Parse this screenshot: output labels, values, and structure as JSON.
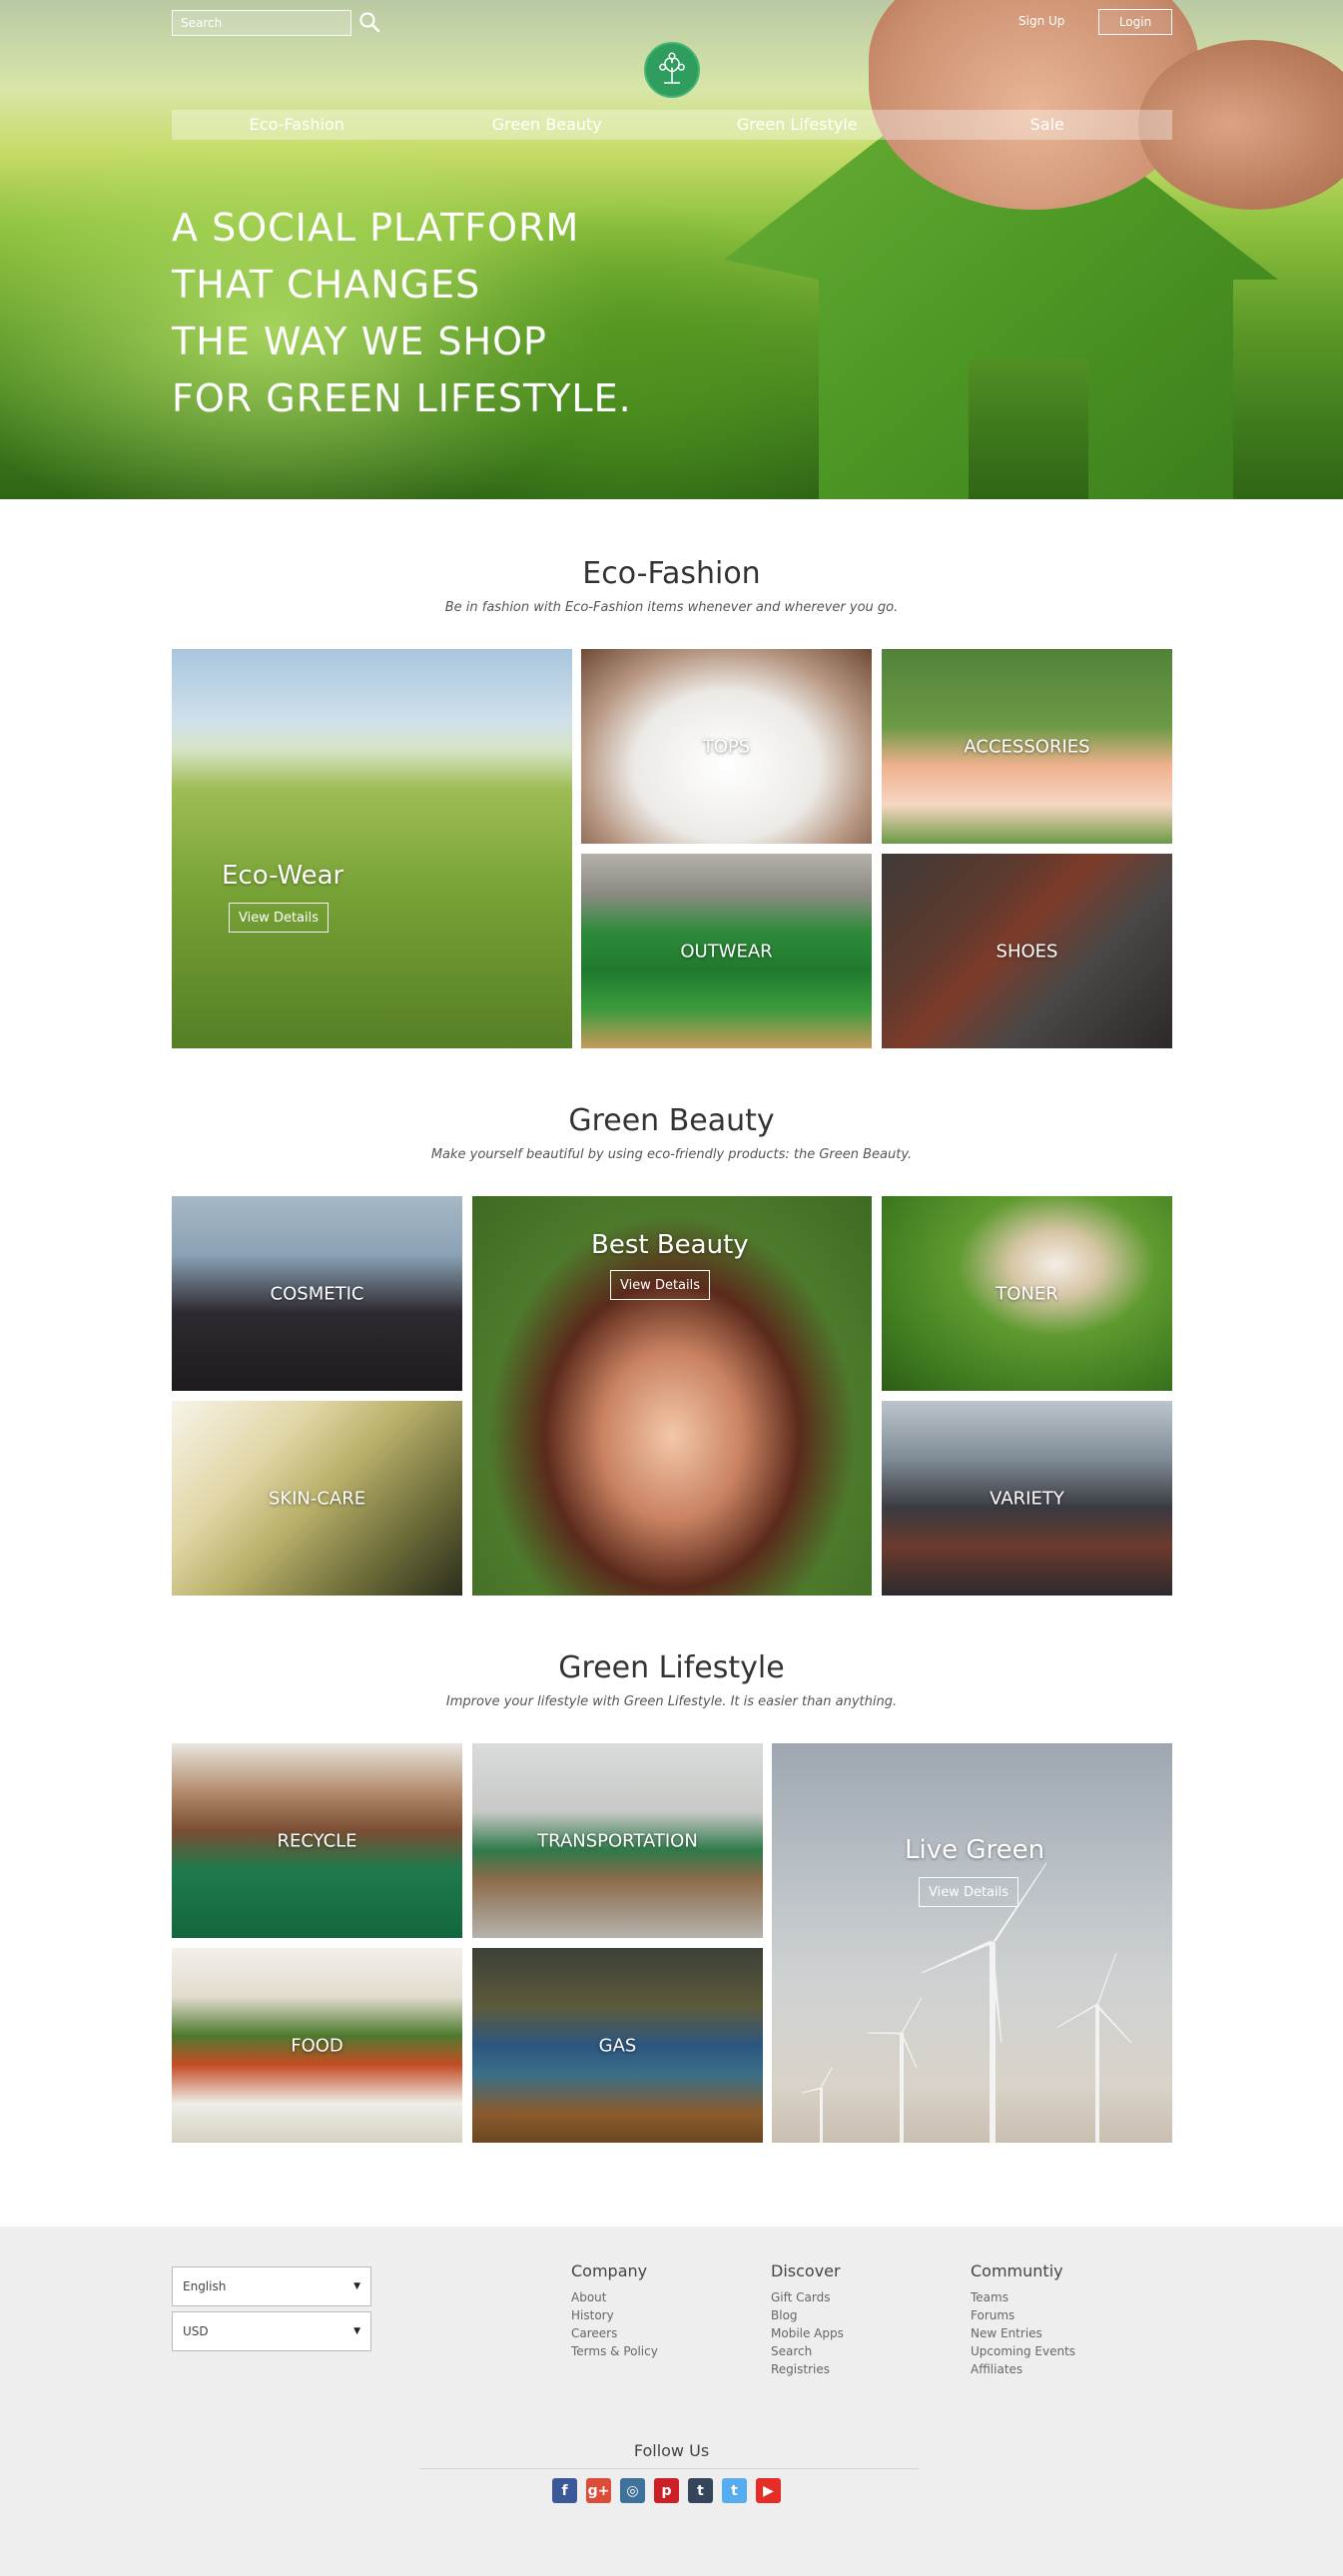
{
  "header": {
    "search_placeholder": "Search",
    "signup_label": "Sign Up",
    "login_label": "Login",
    "nav": [
      "Eco-Fashion",
      "Green Beauty",
      "Green Lifestyle",
      "Sale"
    ],
    "hero_lines": [
      "A SOCIAL PLATFORM",
      "THAT CHANGES",
      "THE WAY WE SHOP",
      "FOR GREEN LIFESTYLE."
    ]
  },
  "eco_fashion": {
    "title": "Eco-Fashion",
    "subtitle": "Be in fashion with Eco-Fashion items whenever and wherever you go.",
    "feature": {
      "title": "Eco-Wear",
      "button": "View Details"
    },
    "tiles": [
      "TOPS",
      "ACCESSORIES",
      "OUTWEAR",
      "SHOES"
    ]
  },
  "green_beauty": {
    "title": "Green Beauty",
    "subtitle": "Make yourself beautiful by using eco-friendly products: the Green Beauty.",
    "feature": {
      "title": "Best Beauty",
      "button": "View Details"
    },
    "tiles": [
      "COSMETIC",
      "SKIN-CARE",
      "TONER",
      "VARIETY"
    ]
  },
  "green_lifestyle": {
    "title": "Green Lifestyle",
    "subtitle": "Improve your lifestyle with Green Lifestyle. It is easier than anything.",
    "feature": {
      "title": "Live Green",
      "button": "View Details"
    },
    "tiles": [
      "RECYCLE",
      "TRANSPORTATION",
      "FOOD",
      "GAS"
    ]
  },
  "footer": {
    "language": "English",
    "currency": "USD",
    "columns": [
      {
        "title": "Company",
        "links": [
          "About",
          "History",
          "Careers",
          "Terms & Policy"
        ]
      },
      {
        "title": "Discover",
        "links": [
          "Gift Cards",
          "Blog",
          "Mobile Apps",
          "Search",
          "Registries"
        ]
      },
      {
        "title": "Communtiy",
        "links": [
          "Teams",
          "Forums",
          "New Entries",
          "Upcoming Events",
          "Affiliates"
        ]
      }
    ],
    "follow_label": "Follow Us",
    "socials": [
      {
        "name": "facebook-icon",
        "glyph": "f",
        "color": "#3b5998"
      },
      {
        "name": "google-plus-icon",
        "glyph": "g+",
        "color": "#dd4b39"
      },
      {
        "name": "instagram-icon",
        "glyph": "◎",
        "color": "#3f729b"
      },
      {
        "name": "pinterest-icon",
        "glyph": "p",
        "color": "#cb2027"
      },
      {
        "name": "tumblr-icon",
        "glyph": "t",
        "color": "#35465c"
      },
      {
        "name": "twitter-icon",
        "glyph": "t",
        "color": "#55acee"
      },
      {
        "name": "youtube-icon",
        "glyph": "▶",
        "color": "#e52d27"
      }
    ]
  },
  "colors": {
    "brand_green": "#2f9d5e",
    "footer_bg": "#eeeeee"
  }
}
